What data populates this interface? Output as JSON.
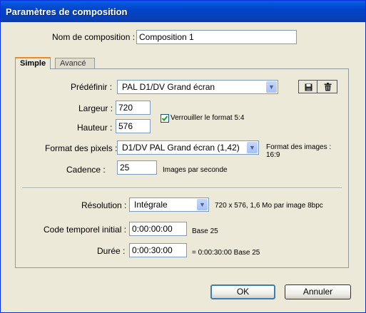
{
  "window": {
    "title": "Paramètres de composition"
  },
  "name_field": {
    "label": "Nom de composition :",
    "value": "Composition 1"
  },
  "tabs": [
    {
      "label": "Simple",
      "active": true
    },
    {
      "label": "Avancé",
      "active": false
    }
  ],
  "preset": {
    "label": "Prédéfinir :",
    "value": "PAL D1/DV Grand écran",
    "save_icon": "floppy-disk-icon",
    "delete_icon": "trash-icon"
  },
  "width": {
    "label": "Largeur :",
    "value": "720"
  },
  "height": {
    "label": "Hauteur :",
    "value": "576"
  },
  "lock_aspect": {
    "label": "Verrouiller le format 5:4",
    "checked": true
  },
  "pixel_aspect": {
    "label": "Format des pixels :",
    "value": "D1/DV PAL Grand écran (1,42)",
    "frame_aspect_label": "Format des images :",
    "frame_aspect_value": "16:9"
  },
  "frame_rate": {
    "label": "Cadence :",
    "value": "25",
    "unit": "Images par seconde"
  },
  "resolution": {
    "label": "Résolution :",
    "value": "Intégrale",
    "info": "720 x 576, 1,6 Mo par image 8bpc"
  },
  "start_timecode": {
    "label": "Code temporel initial :",
    "value": "0:00:00:00",
    "base": "Base 25"
  },
  "duration": {
    "label": "Durée :",
    "value": "0:00:30:00",
    "equals": "= 0:00:30:00  Base 25"
  },
  "buttons": {
    "ok": "OK",
    "cancel": "Annuler"
  },
  "colors": {
    "titlebar": "#0a5fe8",
    "dialog_bg": "#ece9d8",
    "focus_border": "#003c74"
  }
}
